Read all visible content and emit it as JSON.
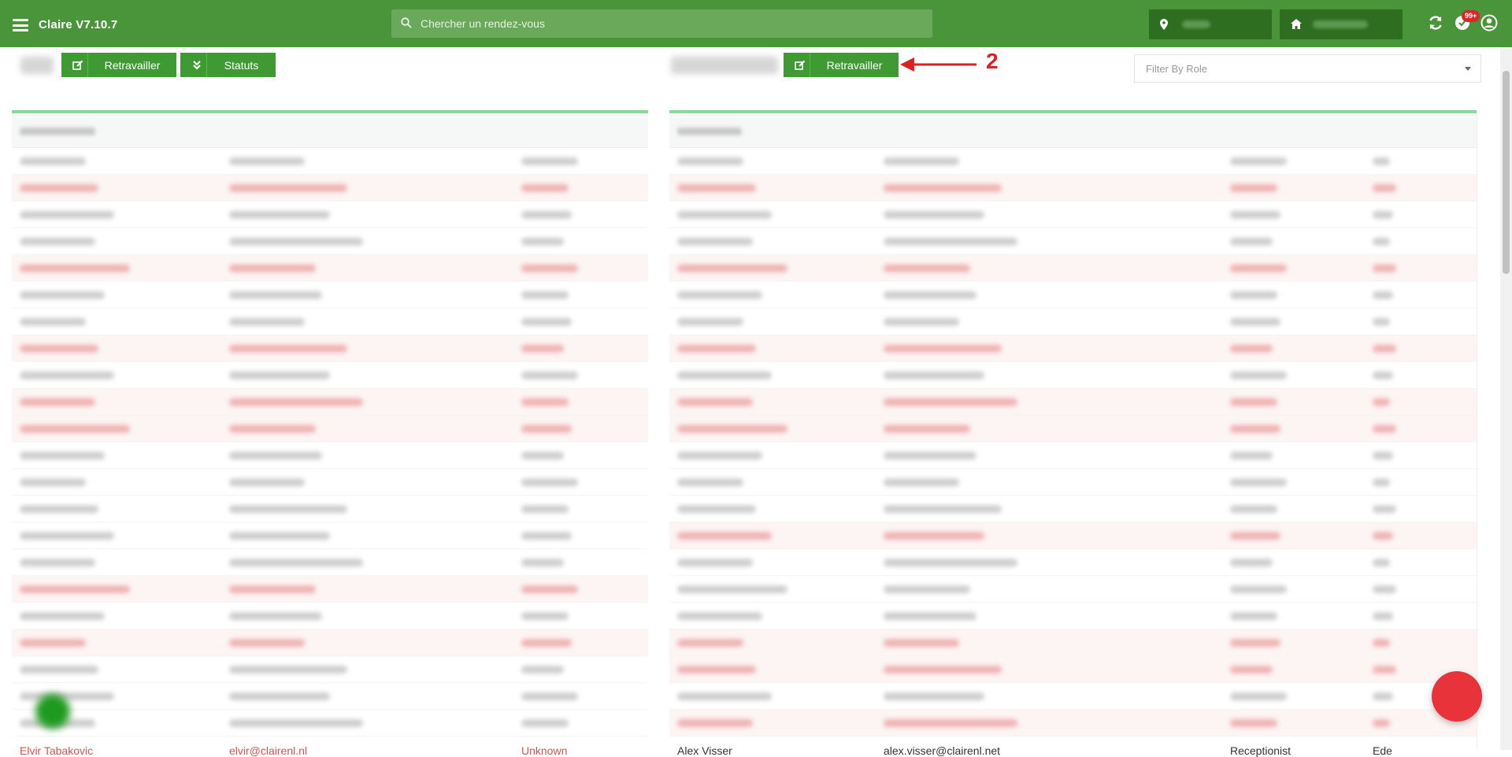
{
  "topbar": {
    "app_title": "Claire V7.10.7",
    "search_placeholder": "Chercher un rendez-vous",
    "notification_count": "99+"
  },
  "header": {
    "left_retravailler": "Retravailler",
    "left_statuts": "Statuts",
    "right_retravailler": "Retravailler",
    "annotation_number": "2",
    "filter_placeholder": "Filter By Role"
  },
  "left_table": {
    "bottom_row": {
      "name": "Elvir Tabakovic",
      "email": "elvir@clairenl.nl",
      "role": "Unknown"
    }
  },
  "right_table": {
    "bottom_row": {
      "name": "Alex Visser",
      "email": "alex.visser@clairenl.net",
      "role": "Receptionist",
      "extra": "Ede"
    }
  },
  "colors": {
    "topbar": "#4a943a",
    "button": "#3f9a34",
    "accent_red": "#e02020",
    "panel_border": "#8fd69b"
  }
}
